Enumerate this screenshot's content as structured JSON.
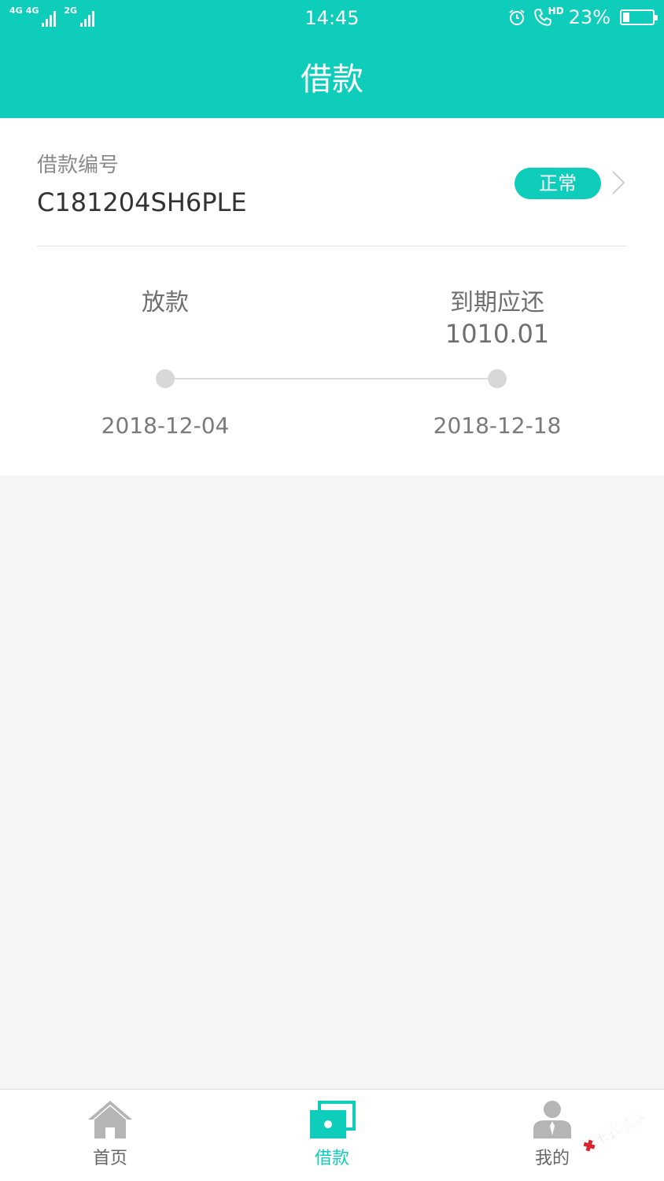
{
  "status_bar": {
    "network_1": "4G",
    "network_2": "4G",
    "network_3": "2G",
    "time": "14:45",
    "call_badge": "HD",
    "battery_percent": "23%",
    "battery_level": 0.23
  },
  "header": {
    "title": "借款",
    "background_color": "#0ecdbb"
  },
  "loan": {
    "number_label": "借款编号",
    "number": "C181204SH6PLE",
    "status": "正常"
  },
  "timeline": {
    "start": {
      "label": "放款",
      "date": "2018-12-04"
    },
    "end": {
      "label": "到期应还",
      "amount": "1010.01",
      "date": "2018-12-18"
    }
  },
  "tabbar": {
    "items": [
      {
        "label": "首页",
        "icon": "home-icon",
        "active": false
      },
      {
        "label": "借款",
        "icon": "loan-card-icon",
        "active": true
      },
      {
        "label": "我的",
        "icon": "user-icon",
        "active": false
      }
    ]
  },
  "watermark": {
    "text": "卡农社区"
  }
}
